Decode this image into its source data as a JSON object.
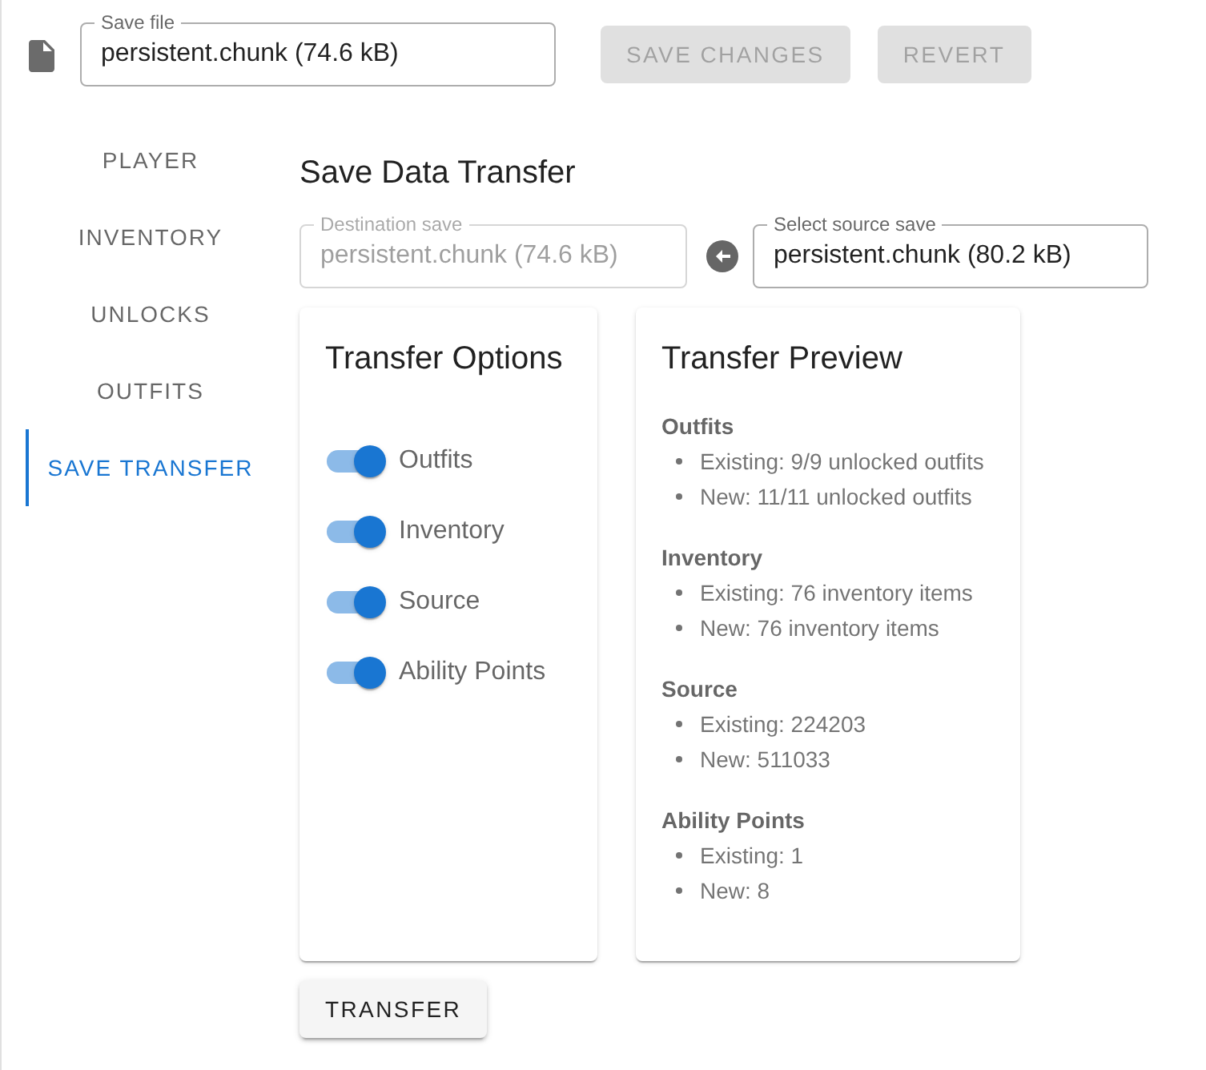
{
  "header": {
    "save_file": {
      "label": "Save file",
      "value": "persistent.chunk (74.6 kB)",
      "disabled": false
    },
    "buttons": [
      {
        "label": "SAVE CHANGES",
        "disabled": true
      },
      {
        "label": "REVERT",
        "disabled": true
      }
    ]
  },
  "sidebar": {
    "items": [
      {
        "label": "PLAYER",
        "selected": false
      },
      {
        "label": "INVENTORY",
        "selected": false
      },
      {
        "label": "UNLOCKS",
        "selected": false
      },
      {
        "label": "OUTFITS",
        "selected": false
      },
      {
        "label": "SAVE TRANSFER",
        "selected": true
      }
    ]
  },
  "transfer": {
    "title": "Save Data Transfer",
    "destination": {
      "label": "Destination save",
      "value": "persistent.chunk (74.6 kB)",
      "disabled": true
    },
    "source": {
      "label": "Select source save",
      "value": "persistent.chunk (80.2 kB)",
      "disabled": false
    }
  },
  "options": {
    "title": "Transfer Options",
    "switches": [
      {
        "label": "Outfits",
        "on": true
      },
      {
        "label": "Inventory",
        "on": true
      },
      {
        "label": "Source",
        "on": true
      },
      {
        "label": "Ability Points",
        "on": true
      }
    ]
  },
  "preview": {
    "title": "Transfer Preview",
    "sections": [
      {
        "heading": "Outfits",
        "items": [
          "Existing: 9/9 unlocked outfits",
          "New: 11/11 unlocked outfits"
        ]
      },
      {
        "heading": "Inventory",
        "items": [
          "Existing: 76 inventory items",
          "New: 76 inventory items"
        ]
      },
      {
        "heading": "Source",
        "items": [
          "Existing: 224203",
          "New: 511033"
        ]
      },
      {
        "heading": "Ability Points",
        "items": [
          "Existing: 1",
          "New: 8"
        ]
      }
    ]
  },
  "transfer_button": {
    "label": "TRANSFER"
  }
}
